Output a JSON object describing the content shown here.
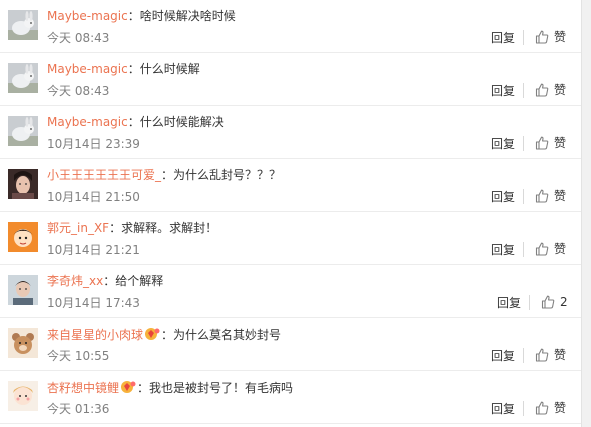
{
  "comments": [
    {
      "user": "Maybe-magic",
      "text": "啥时候解决啥时候",
      "time": "今天 08:43",
      "reply": "回复",
      "like": "赞",
      "avatar": "rabbit",
      "badge": false
    },
    {
      "user": "Maybe-magic",
      "text": "什么时候解",
      "time": "今天 08:43",
      "reply": "回复",
      "like": "赞",
      "avatar": "rabbit",
      "badge": false
    },
    {
      "user": "Maybe-magic",
      "text": "什么时候能解决",
      "time": "10月14日 23:39",
      "reply": "回复",
      "like": "赞",
      "avatar": "rabbit",
      "badge": false
    },
    {
      "user": "小王王王王王王可爱_",
      "text": "为什么乱封号？？？",
      "time": "10月14日 21:50",
      "reply": "回复",
      "like": "赞",
      "avatar": "girl",
      "badge": false
    },
    {
      "user": "郭元_in_XF",
      "text": "求解释。求解封！",
      "time": "10月14日 21:21",
      "reply": "回复",
      "like": "赞",
      "avatar": "cartoon",
      "badge": false
    },
    {
      "user": "李奇炜_xx",
      "text": "给个解释",
      "time": "10月14日 17:43",
      "reply": "回复",
      "like": "2",
      "avatar": "person",
      "badge": false
    },
    {
      "user": "来自星星的小肉球",
      "text": "为什么莫名其妙封号",
      "time": "今天 10:55",
      "reply": "回复",
      "like": "赞",
      "avatar": "bear",
      "badge": true
    },
    {
      "user": "杏籽想中镜鲤",
      "text": "我也是被封号了！有毛病吗",
      "time": "今天 01:36",
      "reply": "回复",
      "like": "赞",
      "avatar": "doll",
      "badge": true
    }
  ],
  "colors": {
    "username": "#eb7350",
    "time": "#808080",
    "text": "#333333"
  },
  "icons": {
    "like": "thumbs-up-icon",
    "badge": "vip-badge-icon"
  }
}
